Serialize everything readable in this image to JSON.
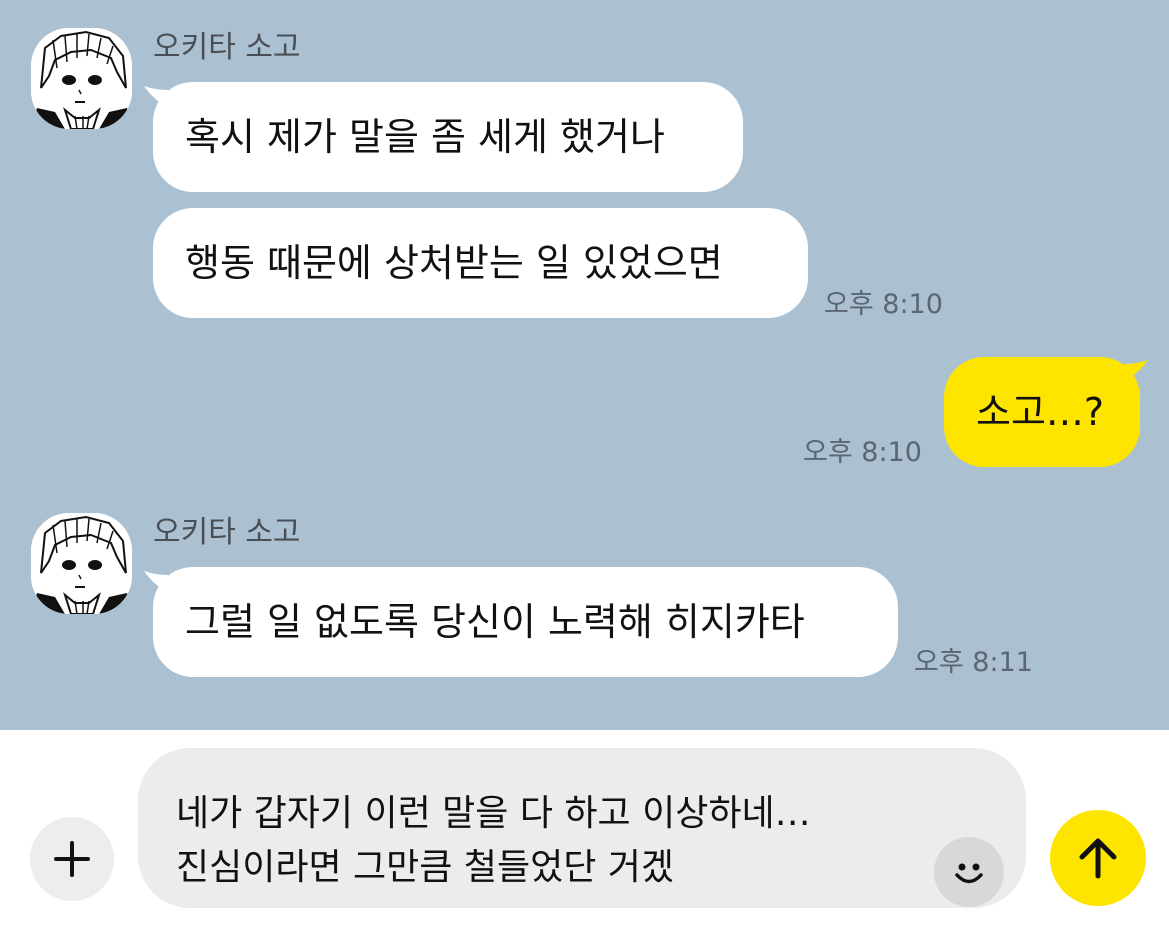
{
  "messages": [
    {
      "sender": "오키타 소고",
      "avatar_icon": "anime-character-avatar-icon",
      "bubbles": [
        "혹시 제가 말을 좀 세게 했거나",
        "행동 때문에 상처받는 일 있었으면"
      ],
      "time": "오후 8:10"
    },
    {
      "outgoing": true,
      "text": "소고…?",
      "time": "오후 8:10"
    },
    {
      "sender": "오키타 소고",
      "avatar_icon": "anime-character-avatar-icon",
      "bubbles": [
        "그럴 일 없도록 당신이 노력해 히지카타"
      ],
      "time": "오후 8:11"
    }
  ],
  "composer": {
    "lines": [
      "네가 갑자기 이런 말을 다 하고 이상하네…",
      "진심이라면 그만큼 철들었단 거겠"
    ],
    "plus_icon": "plus-icon",
    "emoji_icon": "emoji-icon",
    "send_icon": "send-arrow-icon"
  },
  "colors": {
    "chat_background": "#abc1d1",
    "incoming_bubble": "#ffffff",
    "outgoing_bubble": "#fee500",
    "send_button": "#fee500"
  }
}
